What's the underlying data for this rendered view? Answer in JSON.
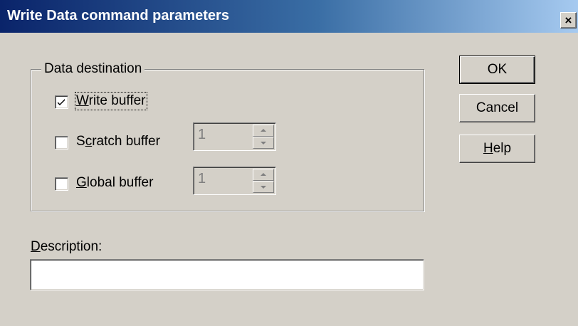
{
  "window": {
    "title": "Write Data command parameters",
    "close_glyph": "×",
    "close_icon": "close-icon"
  },
  "data_destination": {
    "group_label": "Data destination",
    "write_buffer": {
      "label_mnemonic": "W",
      "label_rest": "rite buffer",
      "checked": true
    },
    "scratch_buffer": {
      "label_before": "S",
      "label_mnemonic": "c",
      "label_rest": "ratch buffer",
      "checked": false,
      "spin_value": "1",
      "enabled": false
    },
    "global_buffer": {
      "label_mnemonic": "G",
      "label_rest": "lobal buffer",
      "checked": false,
      "spin_value": "1",
      "enabled": false
    }
  },
  "buttons": {
    "ok_label": "OK",
    "cancel_label": "Cancel",
    "help_mnemonic": "H",
    "help_rest": "elp"
  },
  "description": {
    "label_mnemonic": "D",
    "label_rest": "escription:",
    "value": ""
  }
}
